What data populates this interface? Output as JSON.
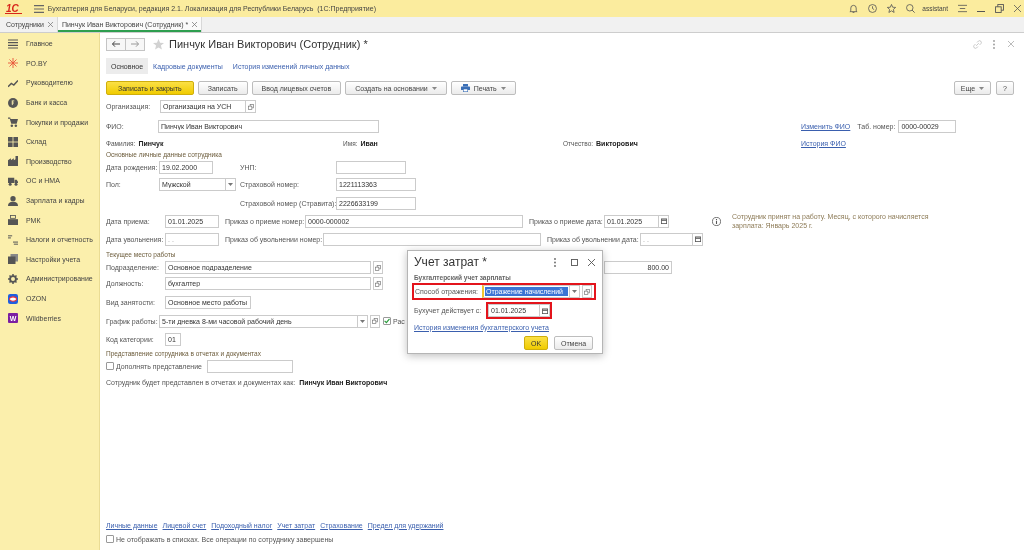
{
  "app_bar": {
    "logo": "1С",
    "title": "Бухгалтерия для Беларуси, редакция 2.1. Локализация для Республики Беларусь  (1С:Предприятие)",
    "user": "assistant"
  },
  "open_tabs": [
    {
      "label": "Сотрудники",
      "selected": false
    },
    {
      "label": "Пинчук Иван Викторович (Сотрудник) *",
      "selected": true
    }
  ],
  "sidebar": {
    "items": [
      {
        "label": "Главное"
      },
      {
        "label": "РО.BY"
      },
      {
        "label": "Руководителю"
      },
      {
        "label": "Банк и касса"
      },
      {
        "label": "Покупки и продажи"
      },
      {
        "label": "Склад"
      },
      {
        "label": "Производство"
      },
      {
        "label": "ОС и НМА"
      },
      {
        "label": "Зарплата и кадры"
      },
      {
        "label": "РМК"
      },
      {
        "label": "Налоги и отчетность"
      },
      {
        "label": "Настройки учета"
      },
      {
        "label": "Администрирование"
      },
      {
        "label": "OZON"
      },
      {
        "label": "Wildberries",
        "badge": "W"
      }
    ]
  },
  "form": {
    "title": "Пинчук Иван Викторович (Сотрудник) *",
    "tabs": [
      {
        "label": "Основное",
        "selected": true
      },
      {
        "label": "Кадровые документы",
        "selected": false
      },
      {
        "label": "История изменений личных данных",
        "selected": false
      }
    ],
    "toolbar": [
      {
        "label": "Записать и закрыть",
        "kind": "primary"
      },
      {
        "label": "Записать",
        "kind": "plain"
      },
      {
        "label": "Ввод лицевых счетов",
        "kind": "plain"
      },
      {
        "label": "Создать на основании",
        "kind": "menu"
      },
      {
        "label": "Печать",
        "kind": "print"
      }
    ],
    "toolbar_right": [
      {
        "label": "Еще",
        "kind": "menu"
      },
      {
        "label": "?",
        "kind": "plain"
      }
    ],
    "organization": {
      "label": "Организация:",
      "value": "Организация на УСН"
    },
    "full_name": {
      "label": "ФИО:",
      "value": "Пинчук Иван Викторович"
    },
    "change_name_link": "Изменить ФИО",
    "tab_number": {
      "label": "Таб. номер:",
      "value": "0000-00029"
    },
    "name_parts": [
      {
        "label": "Фамилия:",
        "value": "Пинчук"
      },
      {
        "label": "Имя:",
        "value": "Иван"
      },
      {
        "label": "Отчество:",
        "value": "Викторович"
      }
    ],
    "name_history_link": "История ФИО",
    "personal": {
      "heading": "Основные личные данные сотрудника",
      "birth_date": {
        "label": "Дата рождения:",
        "value": "19.02.2000"
      },
      "unp": {
        "label": "УНП:"
      },
      "gender": {
        "label": "Пол:",
        "value": "Мужской"
      },
      "insurance_number": {
        "label": "Страховой номер:",
        "value": "1221113363"
      },
      "stravita_number": {
        "label": "Страховой номер (Стравита):",
        "value": "2226633199"
      }
    },
    "hire": {
      "date": {
        "label": "Дата приема:",
        "value": "01.01.2025"
      },
      "order_number": {
        "label": "Приказ о приеме номер:",
        "value": "0000-000002"
      },
      "order_date": {
        "label": "Приказ о приеме дата:",
        "value": "01.01.2025"
      },
      "note": "Сотрудник принят на работу. Месяц, с которого начисляется зарплата: Январь 2025 г."
    },
    "dismissal": {
      "date": {
        "label": "Дата увольнения:",
        "placeholder": ". ."
      },
      "order_number": {
        "label": "Приказ об увольнении номер:"
      },
      "order_date": {
        "label": "Приказ об увольнении дата:",
        "placeholder": ". ."
      }
    },
    "workplace": {
      "heading": "Текущее место работы",
      "department": {
        "label": "Подразделение:",
        "value": "Основное подразделение"
      },
      "amount": "800.00",
      "position": {
        "label": "Должность:",
        "value": "бухгалтер"
      },
      "employment_type": {
        "label": "Вид занятости:",
        "value": "Основное место работы"
      },
      "schedule": {
        "label": "График работы:",
        "value": "5-ти дневка 8-ми часовой рабочий день"
      },
      "schedule_option": {
        "label": "Рас",
        "checked": true
      },
      "category_code": {
        "label": "Код категории:",
        "value": "01"
      }
    },
    "representation": {
      "heading": "Представление сотрудника в отчетах и документах",
      "supplement": {
        "label": "Дополнять представление",
        "checked": false
      },
      "note": "Сотрудник будет представлен в отчетах и документах как: **Пинчук Иван Викторович**"
    },
    "footer_links": [
      "Личные данные",
      "Лицевой счет",
      "Подоходный налог",
      "Учет затрат",
      "Страхование",
      "Предел для удержаний"
    ],
    "hide_in_lists": {
      "label": "Не отображать в списках. Все операции по сотруднику завершены",
      "checked": false
    }
  },
  "dialog": {
    "title": "Учет затрат *",
    "heading": "Бухгалтерский учет зарплаты",
    "method": {
      "label": "Способ отражения:",
      "value": "Отражение начислений",
      "value_selected": true,
      "highlighted": true
    },
    "start": {
      "label": "Бухучет действует с:",
      "value": "01.01.2025",
      "highlighted": true
    },
    "history_link": "История изменения бухгалтерского учета",
    "buttons": [
      {
        "label": "OK",
        "kind": "primary"
      },
      {
        "label": "Отмена",
        "kind": "plain"
      }
    ]
  }
}
